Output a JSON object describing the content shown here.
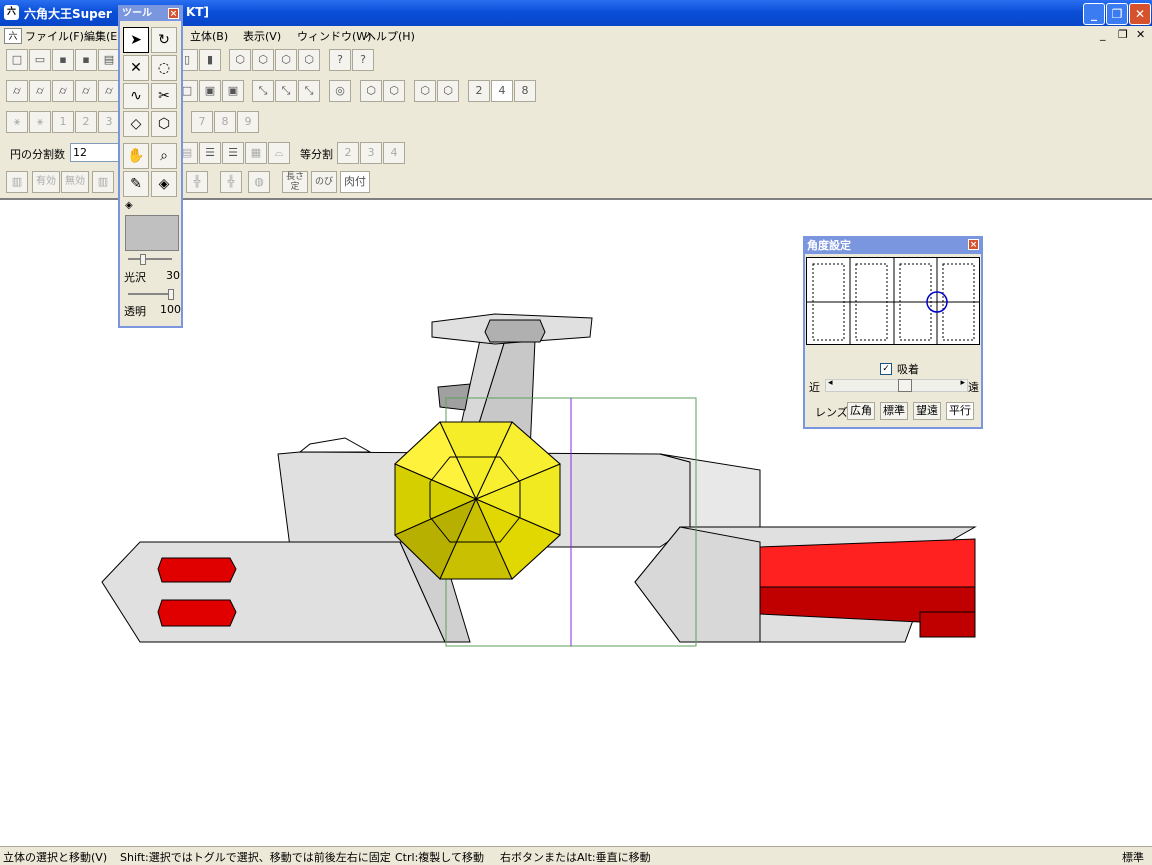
{
  "window": {
    "title": "六角大王Super",
    "title_tail": "KT]",
    "app_icon": "六"
  },
  "menu": [
    {
      "label": "ファイル(F)"
    },
    {
      "label": "編集(E)"
    },
    {
      "label": "立体(B)"
    },
    {
      "label": "表示(V)"
    },
    {
      "label": "ウィンドウ(W)"
    },
    {
      "label": "ヘルプ(H)"
    }
  ],
  "toolbar": {
    "row3_numbers": [
      "1",
      "2",
      "3",
      "7",
      "8",
      "9"
    ],
    "row2_numbers": [
      "2",
      "4",
      "8"
    ],
    "circle_div_label": "円の分割数",
    "circle_div_value": "12",
    "equal_div_label": "等分割",
    "equal_div_numbers": [
      "2",
      "3",
      "4"
    ],
    "valid_label": "有効",
    "invalid_label": "無効",
    "length_label": "長さ",
    "fix_label": "定",
    "stretch_label": "のび",
    "flesh_label": "肉付"
  },
  "tool_palette": {
    "title": "ツール",
    "gloss_label": "光沢",
    "gloss_value": "30",
    "gloss_level": 0.3,
    "transparency_label": "透明",
    "transparency_value": "100",
    "transparency_level": 1.0,
    "swatch_color": "#c0c0c0"
  },
  "angle_panel": {
    "title": "角度設定",
    "snap_label": "吸着",
    "snap_checked": true,
    "near_label": "近",
    "far_label": "遠",
    "lens_label": "レンズ",
    "lens_buttons": [
      "広角",
      "標準",
      "望遠",
      "平行"
    ],
    "selected_lens": "平行"
  },
  "status": {
    "hint1": "立体の選択と移動(V)",
    "hint2": "Shift:選択ではトグルで選択、移動では前後左右に固定",
    "hint3": "Ctrl:複製して移動",
    "hint4": "右ボタンまたはAlt:垂直に移動",
    "mode": "標準"
  },
  "colors": {
    "xp_blue": "#0a4fd8",
    "hub_yellow": "#e8e000",
    "engine_red": "#e00000",
    "hull_gray": "#d9d9d9",
    "selection_green": "#5aa05a",
    "axis_purple": "#8a2be2"
  }
}
